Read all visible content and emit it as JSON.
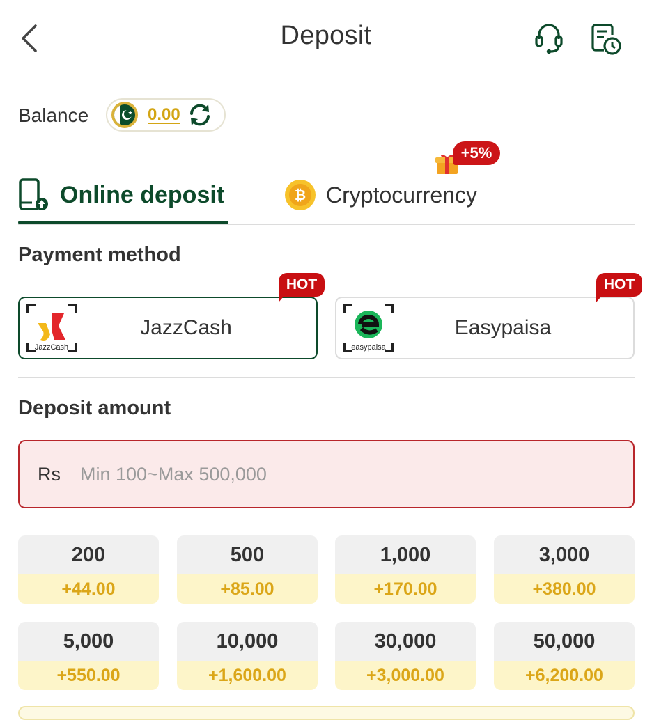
{
  "header": {
    "title": "Deposit"
  },
  "balance": {
    "label": "Balance",
    "value": "0.00"
  },
  "tabs": [
    {
      "label": "Online deposit",
      "active": true
    },
    {
      "label": "Cryptocurrency",
      "active": false,
      "promo": "+5%"
    }
  ],
  "payment": {
    "title": "Payment method",
    "methods": [
      {
        "name": "JazzCash",
        "badge": "HOT",
        "logo_text": "JazzCash",
        "selected": true
      },
      {
        "name": "Easypaisa",
        "badge": "HOT",
        "logo_text": "easypaisa",
        "selected": false
      }
    ]
  },
  "amount": {
    "title": "Deposit amount",
    "currency": "Rs",
    "placeholder": "Min 100~Max 500,000",
    "value": ""
  },
  "presets": [
    {
      "amount": "200",
      "bonus": "+44.00"
    },
    {
      "amount": "500",
      "bonus": "+85.00"
    },
    {
      "amount": "1,000",
      "bonus": "+170.00"
    },
    {
      "amount": "3,000",
      "bonus": "+380.00"
    },
    {
      "amount": "5,000",
      "bonus": "+550.00"
    },
    {
      "amount": "10,000",
      "bonus": "+1,600.00"
    },
    {
      "amount": "30,000",
      "bonus": "+3,000.00"
    },
    {
      "amount": "50,000",
      "bonus": "+6,200.00"
    }
  ],
  "colors": {
    "brand_green": "#0d4a2b",
    "hot_red": "#c80f12",
    "bonus_gold": "#dba618",
    "error_border": "#b8262b"
  },
  "icons": {
    "back": "chevron-left-icon",
    "support": "headset-icon",
    "history": "document-clock-icon",
    "refresh": "refresh-icon",
    "online": "phone-deposit-icon",
    "crypto": "bitcoin-icon",
    "promo": "gift-icon"
  }
}
